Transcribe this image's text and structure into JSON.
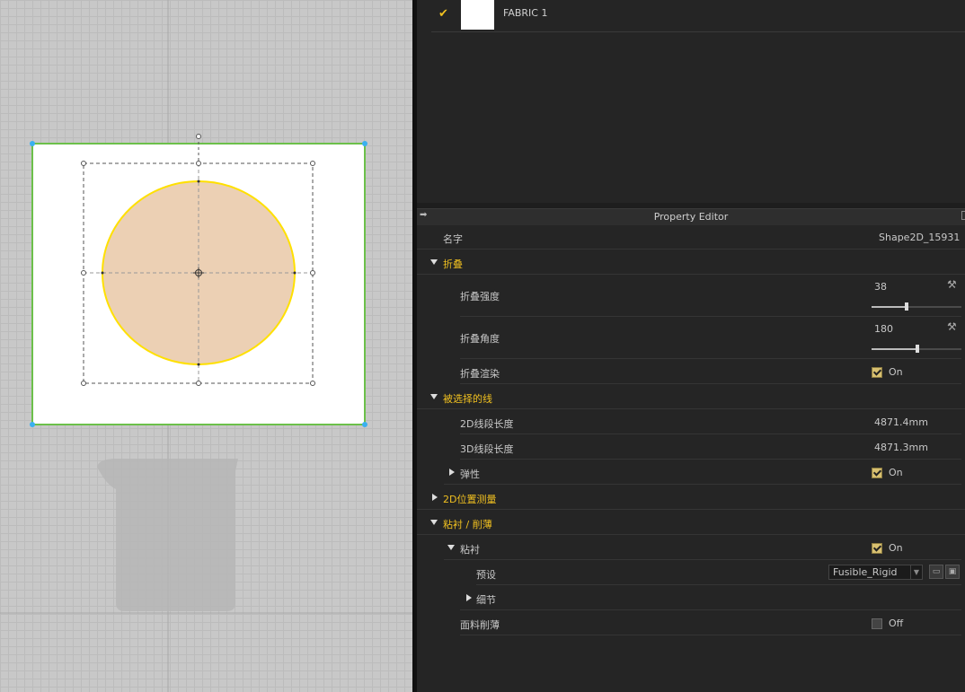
{
  "object_browser": {
    "items": [
      {
        "name": "FABRIC 1",
        "checked": true
      }
    ]
  },
  "property_editor": {
    "title": "Property Editor",
    "name_label": "名字",
    "name_value": "Shape2D_15931",
    "sections": {
      "fold": {
        "label": "折叠",
        "strength_label": "折叠强度",
        "strength_value": "38",
        "strength_slider_fraction": 0.38,
        "angle_label": "折叠角度",
        "angle_value": "180",
        "angle_slider_fraction": 0.5,
        "render_label": "折叠渲染",
        "render_value": "On"
      },
      "selected_line": {
        "label": "被选择的线",
        "len2d_label": "2D线段长度",
        "len2d_value": "4871.4mm",
        "len3d_label": "3D线段长度",
        "len3d_value": "4871.3mm",
        "elastic_label": "弹性",
        "elastic_value": "On"
      },
      "position_measure": {
        "label": "2D位置测量"
      },
      "fuse_skive": {
        "label": "粘衬 / 削薄",
        "fuse_label": "粘衬",
        "fuse_value": "On",
        "preset_label": "预设",
        "preset_value": "Fusible_Rigid",
        "detail_label": "细节",
        "skive_label": "面料削薄",
        "skive_value": "Off"
      }
    }
  },
  "colors": {
    "accent": "#f0c020",
    "pattern_border": "#6cc04a",
    "shape_fill": "#ecd0b4",
    "shape_outline": "#ffe000"
  },
  "icons": [
    "check-icon",
    "pin-icon",
    "wrench-icon",
    "folder-icon",
    "save-icon",
    "dropdown-arrow-icon"
  ]
}
